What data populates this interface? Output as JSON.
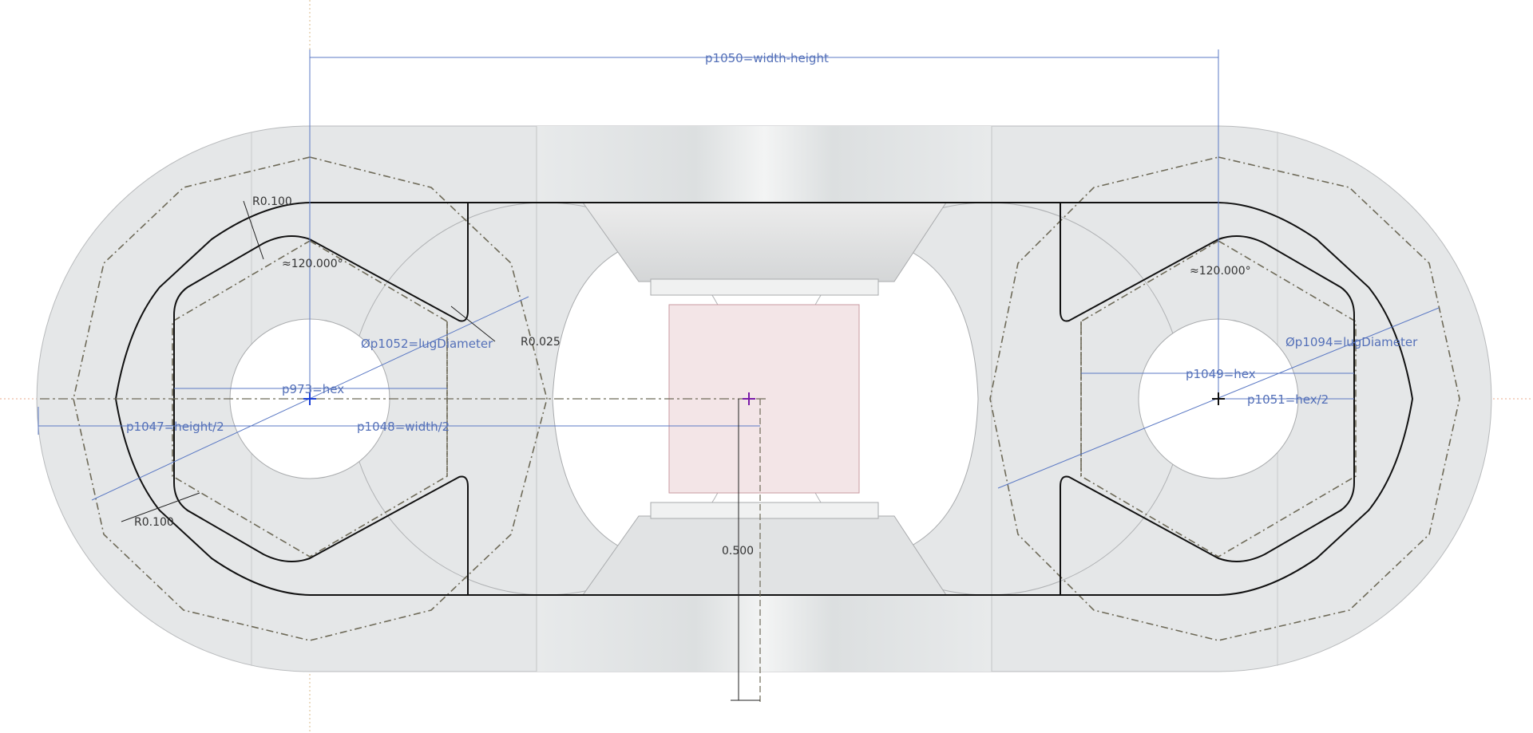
{
  "dimensions": {
    "p1050": "p1050=width-height",
    "p973": "p973=hex",
    "p1047": "p1047=height/2",
    "p1048": "p1048=width/2",
    "p1052": "Øp1052=lugDiameter",
    "p1049": "p1049=hex",
    "p1051": "p1051=hex/2",
    "p1094": "Øp1094=lugDiameter",
    "r_top_left": "R0.100",
    "r_bottom_left": "R0.100",
    "r_slot": "R0.025",
    "angle_left": "≈120.000°",
    "angle_right": "≈120.000°",
    "vertical": "0.500"
  },
  "colors": {
    "dimension": "#5470b8",
    "sketch": "#111111",
    "part_fill": "#e6e8e9",
    "selection_box": "#f2e4e6"
  }
}
